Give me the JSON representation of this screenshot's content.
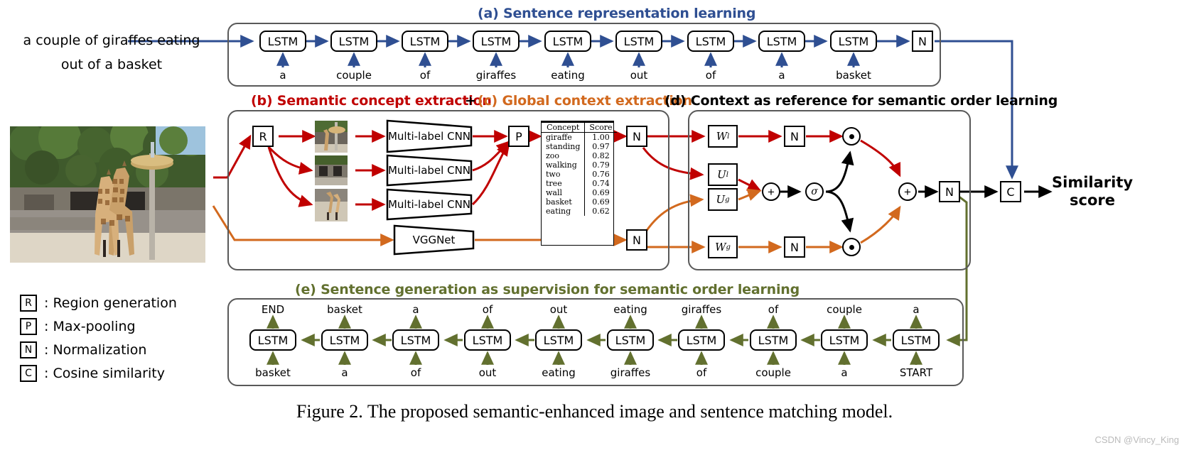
{
  "query": {
    "line1": "a couple of giraffes eating",
    "line2": "out of a basket"
  },
  "sections": {
    "a": {
      "label": "(a) Sentence representation learning",
      "color": "#2f4f92"
    },
    "b": {
      "label": "(b) Semantic concept extraction",
      "color": "#c00000"
    },
    "plus": {
      "label": "+",
      "color": "#000000"
    },
    "c": {
      "label": "(c) Global context extraction",
      "color": "#d2691e"
    },
    "d": {
      "label": "(d) Context as reference for semantic order learning",
      "color": "#000000"
    },
    "e": {
      "label": "(e) Sentence generation as supervision for semantic order learning",
      "color": "#62702f"
    }
  },
  "encoder": {
    "cell_label": "LSTM",
    "norm_label": "N",
    "words": [
      "a",
      "couple",
      "of",
      "giraffes",
      "eating",
      "out",
      "of",
      "a",
      "basket"
    ]
  },
  "concept_branch": {
    "region_label": "R",
    "cnn_label": "Multi-label CNN",
    "cnn_count": 3,
    "pool_label": "P",
    "norm_label": "N"
  },
  "context_branch": {
    "vgg_label": "VGGNet",
    "norm_label": "N"
  },
  "concept_table": {
    "headers": [
      "Concept",
      "Score"
    ],
    "rows": [
      [
        "giraffe",
        "1.00"
      ],
      [
        "standing",
        "0.97"
      ],
      [
        "zoo",
        "0.82"
      ],
      [
        "walking",
        "0.79"
      ],
      [
        "two",
        "0.76"
      ],
      [
        "tree",
        "0.74"
      ],
      [
        "wall",
        "0.69"
      ],
      [
        "basket",
        "0.69"
      ],
      [
        "eating",
        "0.62"
      ]
    ]
  },
  "gating": {
    "w_l": "W",
    "w_l_sub": "l",
    "u_l": "U",
    "u_l_sub": "l",
    "u_g": "U",
    "u_g_sub": "g",
    "w_g": "W",
    "w_g_sub": "g",
    "norm_label": "N",
    "add_label": "+",
    "sigma_label": "σ",
    "mul_label": "⊙"
  },
  "output": {
    "add_label": "+",
    "norm_label": "N",
    "cosine_label": "C",
    "score_line1": "Similarity",
    "score_line2": "score"
  },
  "decoder": {
    "cell_label": "LSTM",
    "outputs": [
      "END",
      "basket",
      "a",
      "of",
      "out",
      "eating",
      "giraffes",
      "of",
      "couple",
      "a"
    ],
    "inputs": [
      "basket",
      "a",
      "of",
      "out",
      "eating",
      "giraffes",
      "of",
      "couple",
      "a",
      "START"
    ]
  },
  "legend": [
    {
      "symbol": "R",
      "text": ": Region generation"
    },
    {
      "symbol": "P",
      "text": ": Max-pooling"
    },
    {
      "symbol": "N",
      "text": ": Normalization"
    },
    {
      "symbol": "C",
      "text": ": Cosine similarity"
    }
  ],
  "caption": "Figure 2. The proposed semantic-enhanced image and sentence matching model.",
  "watermark": "CSDN @Vincy_King",
  "colors": {
    "blue": "#2f4f92",
    "red": "#c00000",
    "orange": "#d2691e",
    "green": "#62702f",
    "black": "#000000",
    "panel_border": "#595959"
  }
}
